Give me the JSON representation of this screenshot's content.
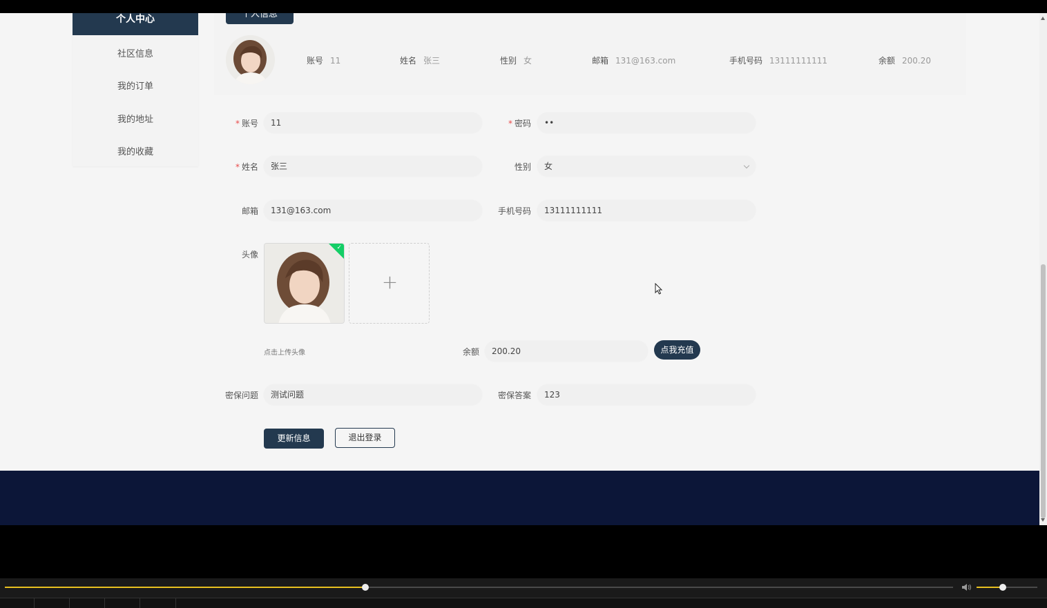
{
  "sidebar": {
    "active": "个人中心",
    "items": [
      {
        "label": "社区信息"
      },
      {
        "label": "我的订单"
      },
      {
        "label": "我的地址"
      },
      {
        "label": "我的收藏"
      }
    ]
  },
  "info_tab": "个人信息",
  "summary": {
    "account_label": "账号",
    "account_value": "11",
    "name_label": "姓名",
    "name_value": "张三",
    "gender_label": "性别",
    "gender_value": "女",
    "email_label": "邮箱",
    "email_value": "131@163.com",
    "phone_label": "手机号码",
    "phone_value": "13111111111",
    "balance_label": "余额",
    "balance_value": "200.20"
  },
  "form": {
    "required_mark": "*",
    "account_label": "账号",
    "account_value": "11",
    "password_label": "密码",
    "password_value": "••",
    "name_label": "姓名",
    "name_value": "张三",
    "gender_label": "性别",
    "gender_value": "女",
    "email_label": "邮箱",
    "email_value": "131@163.com",
    "phone_label": "手机号码",
    "phone_value": "13111111111",
    "avatar_label": "头像",
    "upload_tip": "点击上传头像",
    "balance_label": "余额",
    "balance_value": "200.20",
    "recharge_button": "点我充值",
    "security_question_label": "密保问题",
    "security_question_value": "测试问题",
    "security_answer_label": "密保答案",
    "security_answer_value": "123",
    "update_button": "更新信息",
    "logout_button": "退出登录"
  },
  "colors": {
    "primary": "#23394f",
    "footer": "#0c1638",
    "required": "#e84a4a",
    "upload_success": "#13ce66",
    "player_progress": "#e8c020"
  },
  "player": {
    "progress_fraction": 0.38,
    "volume_fraction": 0.43
  }
}
